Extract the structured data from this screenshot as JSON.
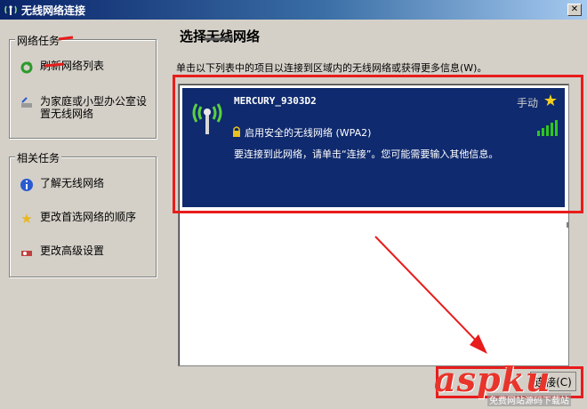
{
  "window": {
    "title": "无线网络连接"
  },
  "sidebar": {
    "network_tasks": {
      "title": "网络任务",
      "items": [
        {
          "label": "刷新网络列表",
          "icon": "refresh-icon"
        },
        {
          "label": "为家庭或小型办公室设置无线网络",
          "icon": "setup-network-icon"
        }
      ]
    },
    "related_tasks": {
      "title": "相关任务",
      "items": [
        {
          "label": "了解无线网络",
          "icon": "info-icon"
        },
        {
          "label": "更改首选网络的顺序",
          "icon": "star-icon"
        },
        {
          "label": "更改高级设置",
          "icon": "settings-icon"
        }
      ]
    }
  },
  "main": {
    "title": "选择无线网络",
    "instruction": "单击以下列表中的项目以连接到区域内的无线网络或获得更多信息(W)。",
    "networks": [
      {
        "ssid": "MERCURY_9303D2",
        "type": "手动",
        "security": "启用安全的无线网络 (WPA2)",
        "description": "要连接到此网络，请单击“连接”。您可能需要输入其他信息。",
        "signal_bars": 5
      }
    ],
    "connect_button": "连接(C)"
  },
  "watermark": {
    "text": "aspku",
    "sub": "免费网站源码下载站"
  },
  "colors": {
    "selected_bg": "#0f2a6e",
    "highlight_box": "#e81c1c",
    "signal": "#2ec81e"
  }
}
